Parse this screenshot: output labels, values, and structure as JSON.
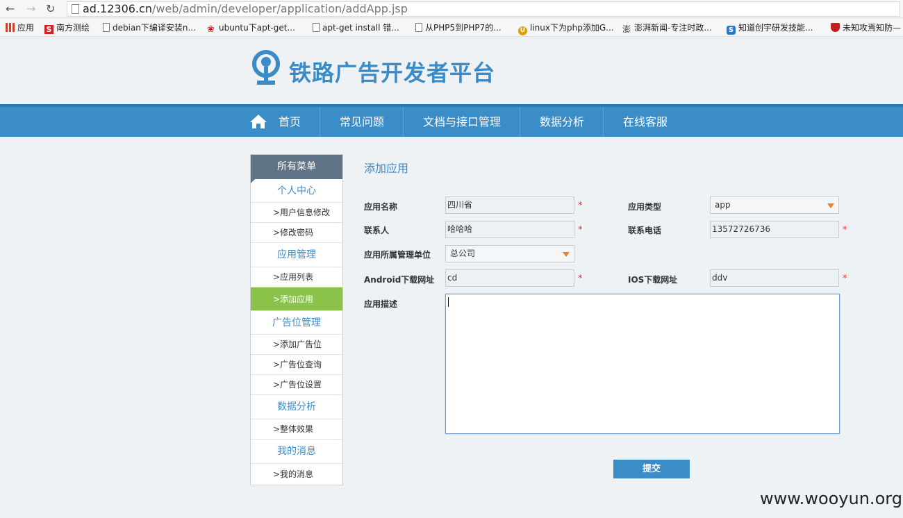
{
  "browser": {
    "url_host": "ad.12306.cn",
    "url_path": "/web/admin/developer/application/addApp.jsp",
    "bookmarks": [
      {
        "label": "应用",
        "icon": "apps-grid-icon",
        "color": "#d04030"
      },
      {
        "label": "南方测绘",
        "icon": "s-logo-icon",
        "color": "#d02020"
      },
      {
        "label": "debian下编译安装n...",
        "icon": "page-icon",
        "color": "#666666"
      },
      {
        "label": "ubuntu下apt-get...",
        "icon": "baidu-paw-icon",
        "color": "#d02020"
      },
      {
        "label": "apt-get install 错...",
        "icon": "page-icon",
        "color": "#666666"
      },
      {
        "label": "从PHP5到PHP7的...",
        "icon": "page-icon",
        "color": "#666666"
      },
      {
        "label": "linux下为php添加G...",
        "icon": "u-circle-icon",
        "color": "#e0a000"
      },
      {
        "label": "澎湃新闻-专注时政...",
        "icon": "thepaper-icon",
        "color": "#333333"
      },
      {
        "label": "知道创宇研发技能...",
        "icon": "knownsec-icon",
        "color": "#2a78c8"
      },
      {
        "label": "未知攻焉知防—",
        "icon": "shield-icon",
        "color": "#c02020"
      }
    ]
  },
  "site": {
    "logo_text": "铁路广告开发者平台",
    "brand_color": "#3b8bc6",
    "nav": [
      {
        "label": "首页",
        "icon": "home-icon"
      },
      {
        "label": "常见问题"
      },
      {
        "label": "文档与接口管理"
      },
      {
        "label": "数据分析"
      },
      {
        "label": "在线客服"
      }
    ]
  },
  "sidebar": {
    "title": "所有菜单",
    "items": [
      {
        "label": "个人中心",
        "type": "group"
      },
      {
        "label": ">用户信息修改",
        "type": "sub"
      },
      {
        "label": ">修改密码",
        "type": "sub"
      },
      {
        "label": "应用管理",
        "type": "group"
      },
      {
        "label": ">应用列表",
        "type": "sub"
      },
      {
        "label": ">添加应用",
        "type": "sub",
        "active": true
      },
      {
        "label": "广告位管理",
        "type": "group"
      },
      {
        "label": ">添加广告位",
        "type": "sub"
      },
      {
        "label": ">广告位查询",
        "type": "sub"
      },
      {
        "label": ">广告位设置",
        "type": "sub"
      },
      {
        "label": "数据分析",
        "type": "group"
      },
      {
        "label": ">整体效果",
        "type": "sub"
      },
      {
        "label": "我的消息",
        "type": "group"
      },
      {
        "label": ">我的消息",
        "type": "sub"
      }
    ]
  },
  "form": {
    "title": "添加应用",
    "app_name_label": "应用名称",
    "app_name_value": "四川省",
    "app_type_label": "应用类型",
    "app_type_value": "app",
    "contact_label": "联系人",
    "contact_value": "哈哈哈",
    "phone_label": "联系电话",
    "phone_value": "13572726736",
    "unit_label": "应用所属管理单位",
    "unit_value": "总公司",
    "android_label": "Android下载网址",
    "android_value": "cd",
    "ios_label": "IOS下载网址",
    "ios_value": "ddv",
    "desc_label": "应用描述",
    "desc_value": "",
    "required_mark": "*",
    "submit_label": "提交"
  },
  "watermark": "www.wooyun.org"
}
